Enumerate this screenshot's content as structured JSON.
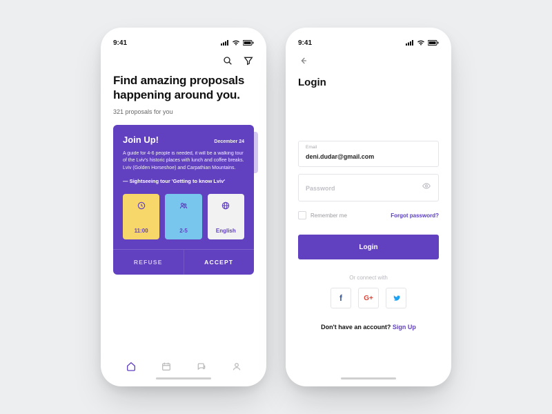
{
  "status": {
    "time": "9:41"
  },
  "phone1": {
    "hero": "Find amazing proposals happening around you.",
    "subcount": "321 proposals for you",
    "card": {
      "title": "Join Up!",
      "date": "December 24",
      "body": "A guide for 4-6 people is needed, it will be a walking tour of the Lviv's historic places with lunch and coffee breaks. Lviv (Golden Horseshoe) and Carpathian Mountains.",
      "tour": "— Sightseeing tour 'Getting to know Lviv'",
      "tiles": {
        "time": "11:00",
        "people": "2-5",
        "lang": "English"
      },
      "actions": {
        "refuse": "REFUSE",
        "accept": "ACCEPT"
      }
    }
  },
  "phone2": {
    "title": "Login",
    "email_label": "Email",
    "email_value": "deni.dudar@gmail.com",
    "password_placeholder": "Password",
    "remember": "Remember me",
    "forgot": "Forgot password?",
    "login_btn": "Login",
    "or": "Or connect with",
    "signup_prompt": "Don't have an account?  ",
    "signup_link": "Sign Up"
  }
}
